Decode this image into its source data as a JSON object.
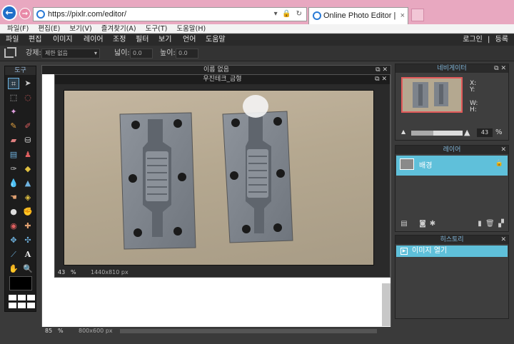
{
  "browser": {
    "url": "https://pixlr.com/editor/",
    "address_controls": "▾ 🔒 ↻",
    "tab_title": "Online Photo Editor | Pixlr ...",
    "tab_close": "×",
    "menu": [
      "파일(F)",
      "편집(E)",
      "보기(V)",
      "즐겨찾기(A)",
      "도구(T)",
      "도움말(H)"
    ]
  },
  "app_menu": {
    "items": [
      "파일",
      "편집",
      "이미지",
      "레이어",
      "조정",
      "필터",
      "보기",
      "언어",
      "도움말"
    ],
    "login": "로그인",
    "separator": "|",
    "register": "등록"
  },
  "options": {
    "mode_label": "강제:",
    "mode_value": "제한 없음",
    "width_label": "넓이:",
    "width_value": "0.0",
    "height_label": "높이:",
    "height_value": "0.0"
  },
  "toolbox": {
    "title": "도구",
    "text_tool": "A"
  },
  "doc_back": {
    "title": "이름 없음",
    "window_controls": "⧉ ✕",
    "zoom": "85",
    "percent": "%",
    "size": "800x600 px"
  },
  "doc_front": {
    "title": "우진테크_금형",
    "window_controls": "⧉ ✕",
    "zoom": "43",
    "percent": "%",
    "size": "1440x810 px"
  },
  "navigator": {
    "title": "네비게이터",
    "window_controls": "⧉ ✕",
    "x_label": "X:",
    "y_label": "Y:",
    "w_label": "W:",
    "h_label": "H:",
    "zoom": "43",
    "percent": "%",
    "zoom_fraction": 0.43
  },
  "layers": {
    "title": "레이어",
    "window_controls": "✕",
    "items": [
      {
        "name": "배경",
        "lock": "🔒"
      }
    ]
  },
  "history": {
    "title": "히스토리",
    "window_controls": "✕",
    "items": [
      "이미지 열기"
    ]
  }
}
